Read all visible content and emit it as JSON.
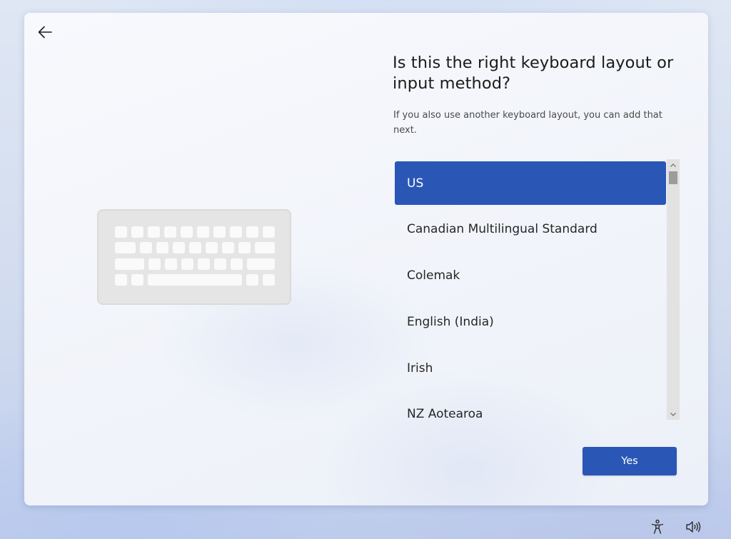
{
  "header": {
    "title": "Is this the right keyboard layout or input method?",
    "subtitle": "If you also use another keyboard layout, you can add that next."
  },
  "layouts": {
    "selected": "US",
    "items": [
      {
        "label": "US",
        "selected": true
      },
      {
        "label": "Canadian Multilingual Standard",
        "selected": false
      },
      {
        "label": "Colemak",
        "selected": false
      },
      {
        "label": "English (India)",
        "selected": false
      },
      {
        "label": "Irish",
        "selected": false
      },
      {
        "label": "NZ Aotearoa",
        "selected": false
      }
    ]
  },
  "actions": {
    "yes_label": "Yes"
  },
  "icons": {
    "back": "back-arrow-icon",
    "illustration": "keyboard-icon",
    "accessibility": "accessibility-icon",
    "volume": "volume-icon",
    "scroll_up": "chevron-up-icon",
    "scroll_down": "chevron-down-icon"
  },
  "colors": {
    "accent": "#2a57b6",
    "selected_text": "#ffffff",
    "scroll_track": "#e2e2e2",
    "scroll_thumb": "#9c9c9c"
  }
}
